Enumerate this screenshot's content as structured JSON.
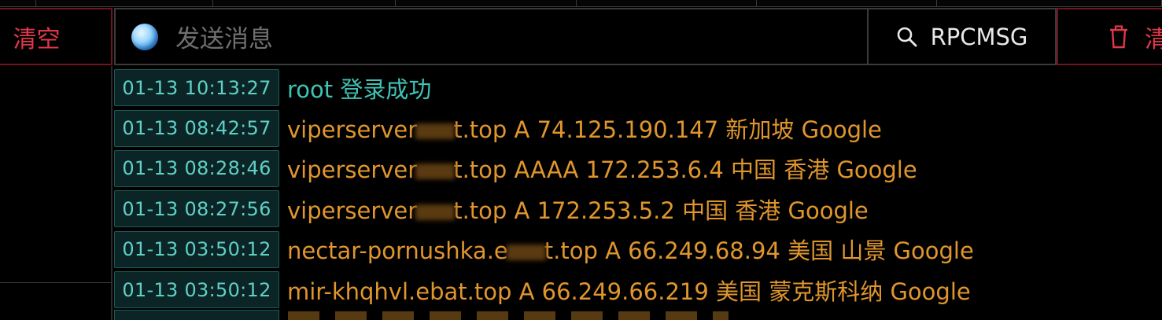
{
  "toolbar": {
    "clear_label": "清空",
    "message_placeholder": "发送消息",
    "rpc_label": "RPCMSG",
    "clear2_label": "清"
  },
  "logs": [
    {
      "time": "01-13 10:13:27",
      "text": "root 登录成功",
      "type": "login"
    },
    {
      "time": "01-13 08:42:57",
      "pre": "viperserver",
      "post": "t.top A 74.125.190.147 新加坡 Google",
      "type": "dns"
    },
    {
      "time": "01-13 08:28:46",
      "pre": "viperserver",
      "post": "t.top AAAA 172.253.6.4 中国 香港 Google",
      "type": "dns"
    },
    {
      "time": "01-13 08:27:56",
      "pre": "viperserver",
      "post": "t.top A 172.253.5.2 中国 香港 Google",
      "type": "dns"
    },
    {
      "time": "01-13 03:50:12",
      "pre": "nectar-pornushka.e",
      "post": "t.top A 66.249.68.94 美国 山景 Google",
      "type": "dns"
    },
    {
      "time": "01-13 03:50:12",
      "text": "mir-khqhvl.ebat.top A 66.249.66.219 美国 蒙克斯科纳 Google",
      "type": "dns"
    }
  ],
  "colors": {
    "timestamp": "#5fd0c6",
    "login": "#3fc3b6",
    "dns": "#e0962d",
    "danger": "#e0384a"
  }
}
